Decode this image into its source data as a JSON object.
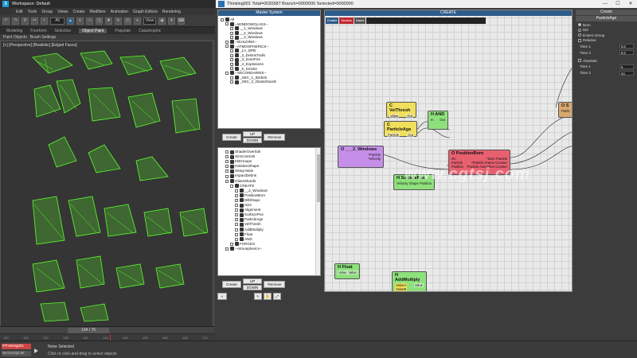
{
  "max": {
    "title": "Workspace: Default",
    "menu": [
      "Edit",
      "Tools",
      "Group",
      "Views",
      "Create",
      "Modifiers",
      "Animation",
      "Graph Editors",
      "Rendering"
    ],
    "toolbar": {
      "filter_value": "All",
      "view_value": "View"
    },
    "ribbon_tabs": [
      "Modeling",
      "Freeform",
      "Selection",
      "Object Paint",
      "Populate",
      "Catastrophic"
    ],
    "ribbon_active": "Object Paint",
    "sub_ribbon": [
      "Paint Objects",
      "Brush Settings"
    ],
    "viewport_label": "[+] [Perspective] [Realistic] [Edged Faces]",
    "time_slider": "134 / 75",
    "ruler_labels": [
      "120",
      "125",
      "130",
      "135",
      "140",
      "145",
      "150",
      "155",
      "160",
      "165",
      "170"
    ],
    "status": {
      "object_field": "#Thinking001",
      "maxscript": "MAXScript Mi:",
      "selected": "None Selected",
      "hint": "Click or click-and-drag to select objects"
    }
  },
  "tp": {
    "title": "Thinking001  Total=0020687  Branch=0000000  Selected=0000000",
    "master_title": "Master System",
    "master_tree": [
      {
        "label": "All",
        "depth": 0
      },
      {
        "label": "--WINDOWGLASS--",
        "depth": 1
      },
      {
        "label": "__1_Windows",
        "depth": 2
      },
      {
        "label": "__2_Windows",
        "depth": 2
      },
      {
        "label": "__3_Windows",
        "depth": 2
      },
      {
        "label": "--BUILDING--",
        "depth": 1
      },
      {
        "label": "--ATMOSPHERICS--",
        "depth": 1
      },
      {
        "label": "_1A_DPB",
        "depth": 2
      },
      {
        "label": "_2_DebrisTrails",
        "depth": 2
      },
      {
        "label": "_3_InnerFire",
        "depth": 2
      },
      {
        "label": "_4_Explosions",
        "depth": 2
      },
      {
        "label": "_5_Smoke",
        "depth": 2
      },
      {
        "label": "--SECONDARIES--",
        "depth": 1
      },
      {
        "label": "_SEC_1_IDebris",
        "depth": 2
      },
      {
        "label": "_SEC_2_GlassShards",
        "depth": 2
      }
    ],
    "buttons_top": {
      "create": "Create",
      "up": "UP",
      "down": "DOWN",
      "remove": "Remove"
    },
    "lower_tree": [
      {
        "label": "ShaderOverride",
        "depth": 1
      },
      {
        "label": "SimControls",
        "depth": 1
      },
      {
        "label": "KBGroups",
        "depth": 1
      },
      {
        "label": "IsolationShape",
        "depth": 1
      },
      {
        "label": "Setup Main",
        "depth": 1
      },
      {
        "label": "ImpactDebris",
        "depth": 1
      },
      {
        "label": "GlassShards",
        "depth": 1
      },
      {
        "label": "CREATE",
        "depth": 2
      },
      {
        "label": "__2_Windows",
        "depth": 3
      },
      {
        "label": "PositionBorn",
        "depth": 3
      },
      {
        "label": "DillShape",
        "depth": 3
      },
      {
        "label": "Size",
        "depth": 3
      },
      {
        "label": "Alignment",
        "depth": 3
      },
      {
        "label": "SurfacePos",
        "depth": 3
      },
      {
        "label": "ParticleAge",
        "depth": 3
      },
      {
        "label": "VelThresh",
        "depth": 3
      },
      {
        "label": "AddMultiply",
        "depth": 3
      },
      {
        "label": "Float",
        "depth": 3
      },
      {
        "label": "AND",
        "depth": 3
      },
      {
        "label": "FORCES",
        "depth": 2
      },
      {
        "label": "--Atmospherics--",
        "depth": 1
      }
    ],
    "buttons_bottom": {
      "create": "Create",
      "up": "UP",
      "down": "DOWN",
      "remove": "Remove"
    },
    "graph_header": "CREATE",
    "graph_tools": [
      "Enable",
      "Disable",
      "Name"
    ],
    "nodes": {
      "windows": {
        "title": "O ___2_Windows",
        "r1": "*Particle",
        "r2": "*Velocity",
        "color": "#c58ee8"
      },
      "velthresh": {
        "title": "C VelThresh",
        "in": "Value",
        "out": "Out",
        "color": "#f0df5c"
      },
      "particleage": {
        "title": "C ParticleAge",
        "in": "Particle",
        "out": "Out",
        "color": "#f0df5c"
      },
      "and": {
        "title": "H AND",
        "in": "In",
        "out": "Out",
        "color": "#8ee07c"
      },
      "surfacepos": {
        "title": "H SurfacePos",
        "in": "Velocity",
        "mid": "Shape",
        "out": "Position",
        "color": "#8ee07c"
      },
      "positionborn": {
        "title": "O PositionBorn",
        "r1a": "On",
        "r1b": "*Born Particle",
        "r2a": "Particle",
        "r2b": "*Particle Frame Counter",
        "r3a": "Position",
        "r3b": "*Particle Animation Counter",
        "color": "#e86070"
      },
      "s_node": {
        "title": "O S",
        "r1": "Partic",
        "color": "#d7a870"
      },
      "float": {
        "title": "H Float",
        "in": "Value",
        "out": "Value",
        "color": "#8ee07c"
      },
      "addmultiply": {
        "title": "H AddMultiply",
        "in": "ValueA",
        "out": "Value",
        "in2": "ValueB",
        "color": "#8ee07c"
      }
    },
    "side": {
      "header_create": "Create",
      "header_node": "ParticleAge",
      "options": [
        "Born",
        "Die",
        "Enters Group",
        "Relative"
      ],
      "time1_label": "Time 1",
      "time1_value": "0.0",
      "time2_label": "Time 2",
      "time2_value": "0.0",
      "absolute": "Absolute",
      "time1b_label": "Time 1",
      "time1b_value": "0",
      "time2b_label": "Time 2",
      "time2b_value": "24"
    }
  },
  "watermark": "www.cgtsj.com",
  "colors": {
    "accent": "#2e5c8a",
    "mesh": "#5cff2c"
  }
}
